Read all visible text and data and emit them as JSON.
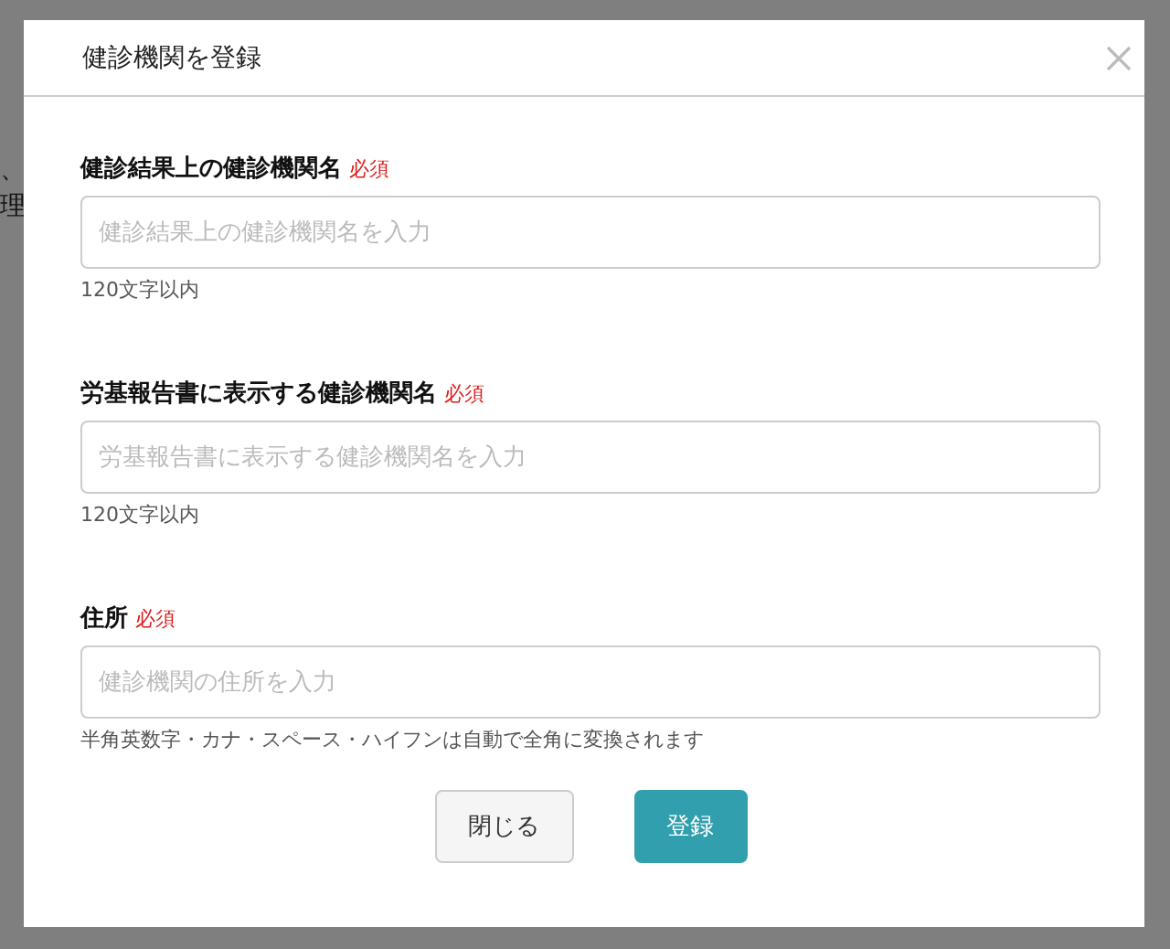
{
  "background_texts": [
    "、",
    "理"
  ],
  "dialog": {
    "title": "健診機関を登録"
  },
  "fields": [
    {
      "label": "健診結果上の健診機関名",
      "required_mark": "必須",
      "placeholder": "健診結果上の健診機関名を入力",
      "hint": "120文字以内"
    },
    {
      "label": "労基報告書に表示する健診機関名",
      "required_mark": "必須",
      "placeholder": "労基報告書に表示する健診機関名を入力",
      "hint": "120文字以内"
    },
    {
      "label": "住所",
      "required_mark": "必須",
      "placeholder": "健診機関の住所を入力",
      "hint": "半角英数字・カナ・スペース・ハイフンは自動で全角に変換されます"
    }
  ],
  "buttons": [
    {
      "label": "閉じる",
      "kind": "secondary"
    },
    {
      "label": "登録",
      "kind": "primary"
    }
  ]
}
